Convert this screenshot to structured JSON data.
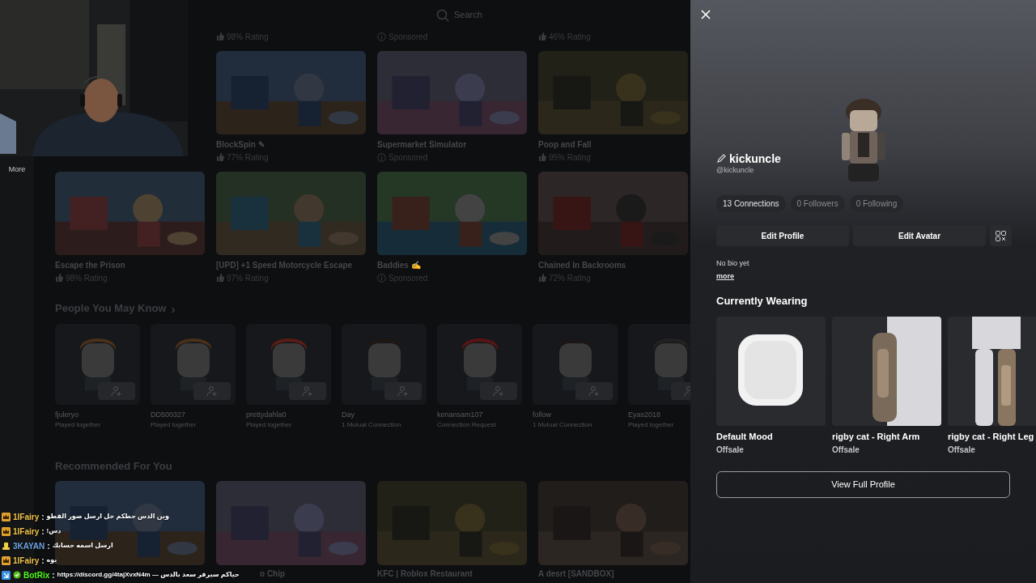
{
  "search": {
    "placeholder": "Search"
  },
  "sidebar": {
    "items": [
      {
        "label": "More"
      }
    ]
  },
  "game_rows": [
    {
      "cards": [
        {
          "kind": "rating",
          "meta": "98% Rating"
        },
        {
          "kind": "sponsored",
          "meta": "Sponsored"
        },
        {
          "kind": "rating",
          "meta": "46% Rating"
        }
      ]
    },
    {
      "cards": [
        {
          "title": "BlockSpin ✎",
          "kind": "rating",
          "meta": "77% Rating"
        },
        {
          "title": "Supermarket Simulator",
          "kind": "sponsored",
          "meta": "Sponsored"
        },
        {
          "title": "Poop and Fall",
          "kind": "rating",
          "meta": "95% Rating"
        }
      ]
    },
    {
      "cards": [
        {
          "title": "Escape the Prison",
          "kind": "rating",
          "meta": "98% Rating"
        },
        {
          "title": "[UPD] +1 Speed Motorcycle Escape",
          "kind": "rating",
          "meta": "97% Rating"
        },
        {
          "title": "Baddies ✍",
          "kind": "sponsored",
          "meta": "Sponsored"
        },
        {
          "title": "Chained In Backrooms",
          "kind": "rating",
          "meta": "72% Rating"
        }
      ]
    }
  ],
  "people_section": {
    "heading": "People You May Know",
    "arrow": "›",
    "people": [
      {
        "name": "fjuleryo",
        "note": "Played together"
      },
      {
        "name": "DD500327",
        "note": "Played together"
      },
      {
        "name": "prettydahla0",
        "note": "Played together"
      },
      {
        "name": "Day",
        "note": "1 Mutual Connection"
      },
      {
        "name": "kenansam107",
        "note": "Connection Request"
      },
      {
        "name": "follow",
        "note": "1 Mutual Connection"
      },
      {
        "name": "Eyas2018",
        "note": "Played together"
      }
    ]
  },
  "recommended": {
    "heading": "Recommended For You",
    "cards": [
      {
        "title": "o Chip"
      },
      {
        "title": "KFC | Roblox Restaurant"
      },
      {
        "title": "A desrt [SANDBOX]"
      }
    ]
  },
  "profile": {
    "display_name": "kickuncle",
    "username": "@kickuncle",
    "stats": [
      {
        "label": "13 Connections",
        "active": true
      },
      {
        "label": "0 Followers",
        "active": false
      },
      {
        "label": "0 Following",
        "active": false
      }
    ],
    "buttons": [
      "Edit Profile",
      "Edit Avatar"
    ],
    "bio": "No bio yet",
    "more_link": "more",
    "wearing_heading": "Currently Wearing",
    "items": [
      {
        "kind": "face",
        "name": "Default Mood",
        "status": "Offsale"
      },
      {
        "kind": "arm",
        "name": "rigby cat - Right Arm",
        "status": "Offsale"
      },
      {
        "kind": "leg",
        "name": "rigby cat - Right Leg",
        "status": "Offsale"
      }
    ],
    "view_button": "View Full Profile"
  },
  "chat": [
    {
      "kind": "crown",
      "user": "1IFairy",
      "color": "#f0c24a",
      "separator": ":",
      "message": "وين الدس حطكم خل ارسل صور القطو"
    },
    {
      "kind": "crown",
      "user": "1IFairy",
      "color": "#f0c24a",
      "separator": ":",
      "message": "دس!"
    },
    {
      "kind": "hat",
      "user": "3KAYAN",
      "color": "#6fa3e0",
      "separator": ":",
      "message": "ارسل اسمه حسابك"
    },
    {
      "kind": "crown",
      "user": "1IFairy",
      "color": "#f0c24a",
      "separator": ":",
      "message": "يوه"
    },
    {
      "kind": "bot",
      "user": "BotRix",
      "color": "#53fc18",
      "separator": ":",
      "message": "https://discord.gg/4tajXvxN4m — حياكم سيرفر سعد بالدس"
    }
  ]
}
